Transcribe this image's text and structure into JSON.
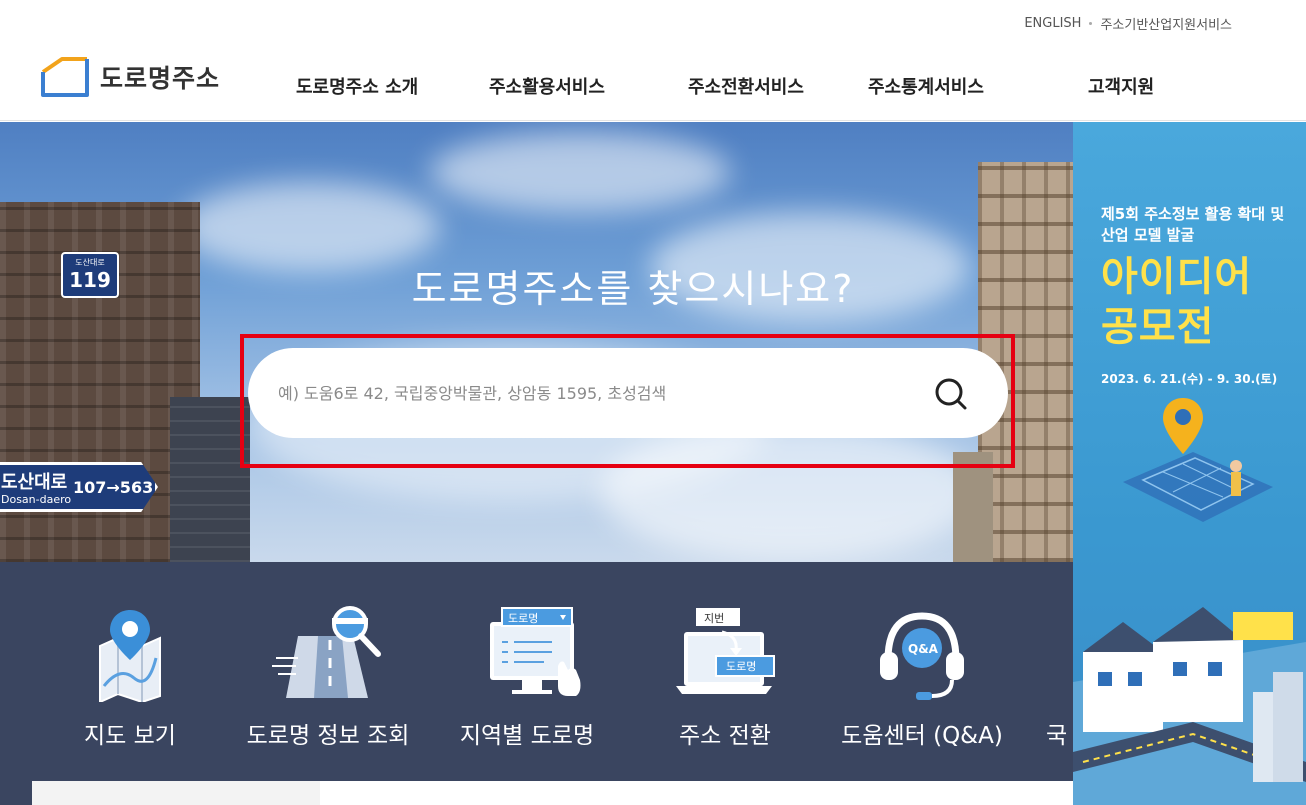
{
  "header": {
    "util_links": [
      "ENGLISH",
      "주소기반산업지원서비스"
    ],
    "logo_text": "도로명주소",
    "nav": [
      "도로명주소 소개",
      "주소활용서비스",
      "주소전환서비스",
      "주소통계서비스",
      "고객지원"
    ]
  },
  "hero": {
    "title": "도로명주소를 찾으시나요?",
    "search_placeholder": "예) 도움6로 42, 국립중앙박물관, 상암동 1595, 초성검색",
    "sign_small": "도산대로",
    "sign_number": "119",
    "road_sign_name": "도산대로",
    "road_sign_roman": "Dosan-daero",
    "road_sign_range": "107→563"
  },
  "quick_menu": [
    {
      "label": "지도 보기",
      "icon": "map-pin-icon"
    },
    {
      "label": "도로명 정보 조회",
      "icon": "road-search-icon"
    },
    {
      "label": "지역별 도로명",
      "icon": "region-monitor-icon",
      "badge": "도로명"
    },
    {
      "label": "주소 전환",
      "icon": "address-convert-icon",
      "badge_top": "지번",
      "badge_bottom": "도로명"
    },
    {
      "label": "도움센터 (Q&A)",
      "icon": "headset-qa-icon",
      "badge": "Q&A"
    },
    {
      "label": "국",
      "icon": ""
    }
  ],
  "banner": {
    "title": "제5회 주소정보 활용 확대 및 산업 모델 발굴",
    "big_line1": "아이디어",
    "big_line2": "공모전",
    "date": "2023. 6. 21.(수) - 9. 30.(토)"
  },
  "colors": {
    "quick_bg": "#3a4560",
    "banner_bg": "#3a98d0",
    "banner_accent": "#ffe14a",
    "highlight": "#e60012",
    "brand_blue": "#3b7fd1"
  }
}
